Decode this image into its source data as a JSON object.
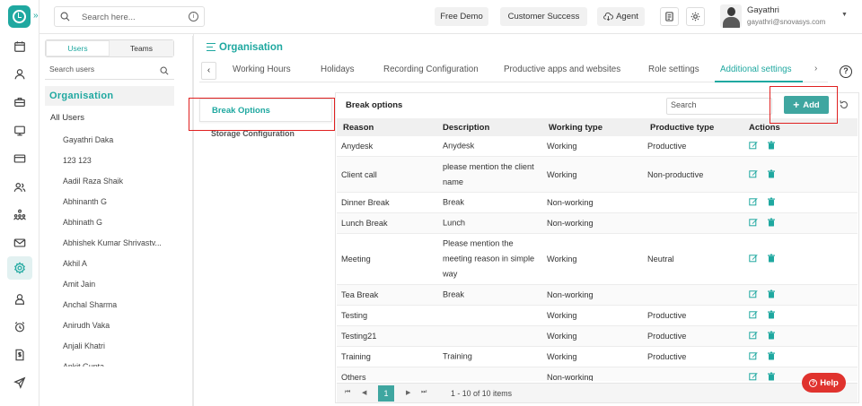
{
  "topbar": {
    "search_placeholder": "Search here...",
    "free_demo": "Free Demo",
    "customer_success": "Customer Success",
    "agent": "Agent",
    "user_name": "Gayathri",
    "user_email": "gayathri@snovasys.com"
  },
  "rail": {
    "icons": [
      "dashboard-calendar-icon",
      "user-icon",
      "briefcase-icon",
      "monitor-icon",
      "card-icon",
      "team-icon",
      "hierarchy-icon",
      "mail-icon",
      "settings-icon",
      "employee-icon",
      "alarm-icon",
      "invoice-icon",
      "send-icon"
    ]
  },
  "users_panel": {
    "tab_users": "Users",
    "tab_teams": "Teams",
    "search_placeholder": "Search users",
    "org_heading": "Organisation",
    "all_users": "All Users",
    "users": [
      "Gayathri Daka",
      "123 123",
      "Aadil Raza Shaik",
      "Abhinanth G",
      "Abhinath G",
      "Abhishek Kumar Shrivastv...",
      "Akhil A",
      "Amit Jain",
      "Anchal Sharma",
      "Anirudh Vaka",
      "Anjali Khatri",
      "Ankit Gupta"
    ]
  },
  "main": {
    "title": "Organisation",
    "tabs": [
      "Working Hours",
      "Holidays",
      "Recording Configuration",
      "Productive apps and websites",
      "Role settings",
      "Additional settings"
    ],
    "active_tab": "Additional settings",
    "subnav": [
      "Break Options",
      "Storage Configuration"
    ]
  },
  "card": {
    "title": "Break options",
    "search_placeholder": "Search",
    "add_label": "Add",
    "columns": [
      "Reason",
      "Description",
      "Working type",
      "Productive type",
      "Actions"
    ],
    "rows": [
      {
        "reason": "Anydesk",
        "description": "Anydesk",
        "working_type": "Working",
        "productive_type": "Productive"
      },
      {
        "reason": "Client call",
        "description": "please mention the client name",
        "working_type": "Working",
        "productive_type": "Non-productive"
      },
      {
        "reason": "Dinner Break",
        "description": "Break",
        "working_type": "Non-working",
        "productive_type": ""
      },
      {
        "reason": "Lunch Break",
        "description": "Lunch",
        "working_type": "Non-working",
        "productive_type": ""
      },
      {
        "reason": "Meeting",
        "description": "Please mention the meeting reason in simple way",
        "working_type": "Working",
        "productive_type": "Neutral"
      },
      {
        "reason": "Tea Break",
        "description": "Break",
        "working_type": "Non-working",
        "productive_type": ""
      },
      {
        "reason": "Testing",
        "description": "",
        "working_type": "Working",
        "productive_type": "Productive"
      },
      {
        "reason": "Testing21",
        "description": "",
        "working_type": "Working",
        "productive_type": "Productive"
      },
      {
        "reason": "Training",
        "description": "Training",
        "working_type": "Working",
        "productive_type": "Productive"
      },
      {
        "reason": "Others",
        "description": "",
        "working_type": "Non-working",
        "productive_type": ""
      }
    ],
    "pager": {
      "current_page": "1",
      "info": "1 - 10 of 10 items"
    }
  },
  "help_label": "Help",
  "colors": {
    "accent": "#1fa8a0",
    "add_button": "#3fa6a0",
    "help": "#e0332e",
    "highlight_box": "#e02020"
  }
}
